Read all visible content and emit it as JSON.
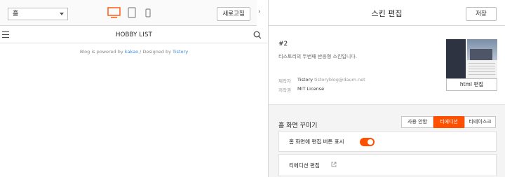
{
  "preview": {
    "category_select": "홈",
    "devices": [
      {
        "name": "desktop",
        "active": true
      },
      {
        "name": "tablet",
        "active": false
      },
      {
        "name": "mobile",
        "active": false
      }
    ],
    "refresh_label": "새로고침",
    "collapse_glyph": "›"
  },
  "blog": {
    "title": "HOBBY LIST",
    "footer_prefix": "Blog is powered by ",
    "footer_link1": "kakao",
    "footer_middle": " / Designed by ",
    "footer_link2": "Tistory"
  },
  "editor": {
    "title": "스킨 편집",
    "save_label": "저장",
    "skin": {
      "number": "#2",
      "description": "티스토리의 두번째 반응형 스킨입니다.",
      "maker_label": "제작자",
      "maker_name": "Tistory",
      "maker_email": "tistoryblog@daum.net",
      "license_label": "저작권",
      "license_value": "MIT License"
    },
    "html_edit_label": "html 편집",
    "home": {
      "label": "홈 화면 꾸미기",
      "tabs": [
        {
          "label": "사용 안함",
          "active": false
        },
        {
          "label": "티에디션",
          "active": true
        },
        {
          "label": "티테이스크",
          "active": false
        }
      ],
      "toggle_label": "홈 화면에 편집 버튼 표시",
      "toggle_on": true,
      "edition_edit_label": "티에디션 편집"
    }
  },
  "colors": {
    "accent": "#ff5000",
    "link": "#3a8bd6"
  }
}
